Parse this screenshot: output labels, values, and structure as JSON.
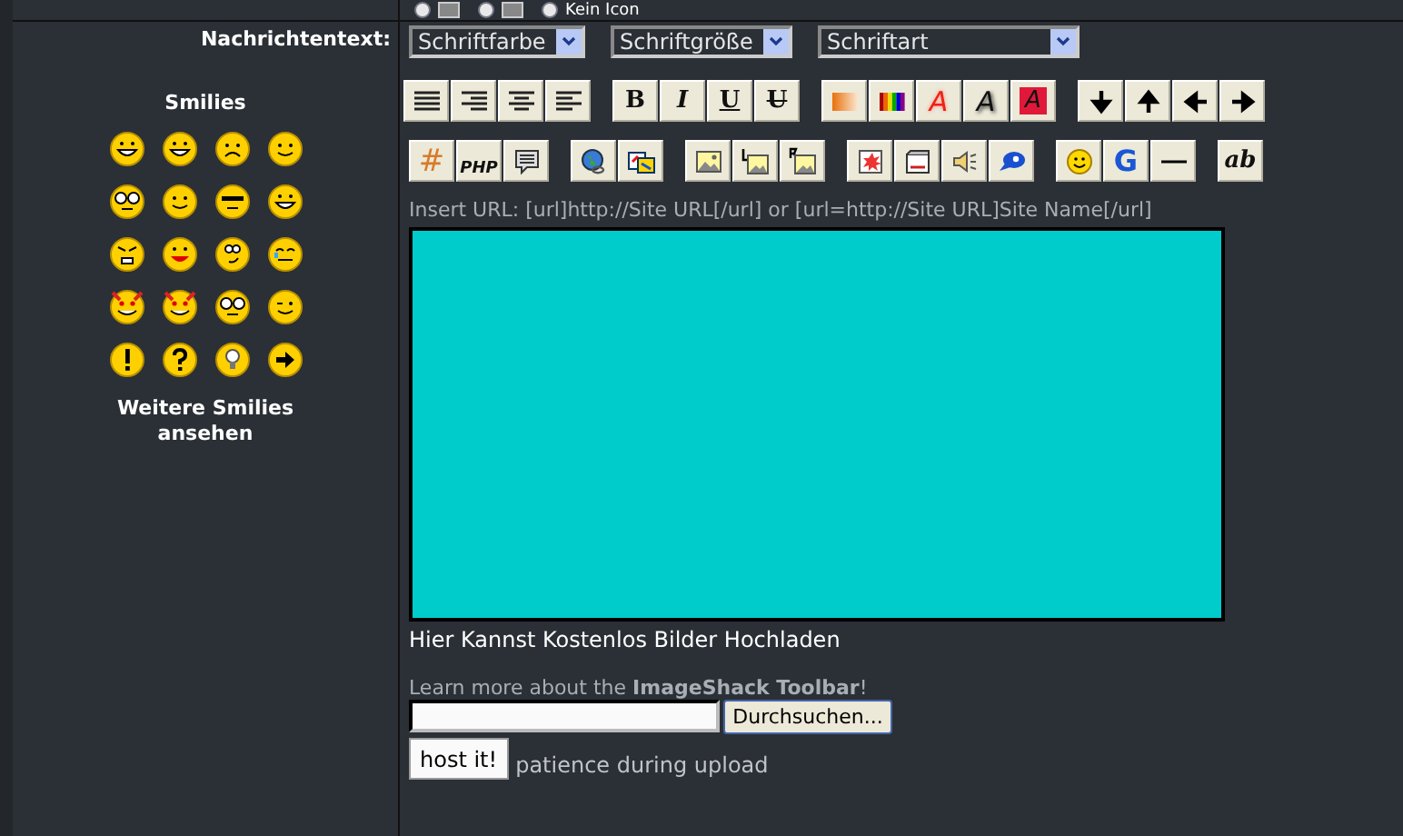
{
  "icon_options": [
    {
      "kind": "icon",
      "selected": false
    },
    {
      "kind": "icon",
      "selected": false
    },
    {
      "kind": "text",
      "label": "Kein Icon",
      "selected": false
    }
  ],
  "message_label": "Nachrichtentext:",
  "smilies": {
    "title": "Smilies",
    "more_link": "Weitere Smilies ansehen"
  },
  "font_selects": [
    {
      "value": "Schriftfarbe"
    },
    {
      "value": "Schriftgröße"
    },
    {
      "value": "Schriftart"
    }
  ],
  "toolbar_rows": [
    [
      [
        {
          "kind": "icon"
        },
        {
          "kind": "icon"
        },
        {
          "kind": "icon"
        },
        {
          "kind": "icon"
        }
      ],
      [
        {
          "kind": "text",
          "label": "B"
        },
        {
          "kind": "text",
          "label": "I"
        },
        {
          "kind": "text",
          "label": "U"
        },
        {
          "kind": "text",
          "label": "U"
        }
      ],
      [
        {
          "kind": "icon"
        },
        {
          "kind": "icon"
        },
        {
          "kind": "text",
          "label": "A"
        },
        {
          "kind": "text",
          "label": "A"
        },
        {
          "kind": "text",
          "label": "A"
        }
      ],
      [
        {
          "kind": "icon"
        },
        {
          "kind": "icon"
        },
        {
          "kind": "icon"
        },
        {
          "kind": "icon"
        }
      ]
    ],
    [
      [
        {
          "kind": "text",
          "label": "#"
        },
        {
          "kind": "text",
          "label": "PHP"
        },
        {
          "kind": "icon"
        }
      ],
      [
        {
          "kind": "icon"
        },
        {
          "kind": "icon"
        }
      ],
      [
        {
          "kind": "icon"
        },
        {
          "kind": "icon"
        },
        {
          "kind": "icon"
        }
      ],
      [
        {
          "kind": "icon"
        },
        {
          "kind": "icon"
        },
        {
          "kind": "icon"
        },
        {
          "kind": "icon"
        }
      ],
      [
        {
          "kind": "icon"
        },
        {
          "kind": "text",
          "label": "G"
        },
        {
          "kind": "icon"
        }
      ],
      [
        {
          "kind": "text",
          "label": "ab"
        }
      ]
    ]
  ],
  "url_hint": "Insert URL: [url]http://Site URL[/url] or [url=http://Site URL]Site Name[/url]",
  "upload": {
    "title": "Hier Kannst Kostenlos Bilder Hochladen",
    "learn_more": "Learn more about the **ImageShack Toolbar**!",
    "browse_button": "Durchsuchen...",
    "host_button": "host it!",
    "patience": "patience during upload"
  }
}
